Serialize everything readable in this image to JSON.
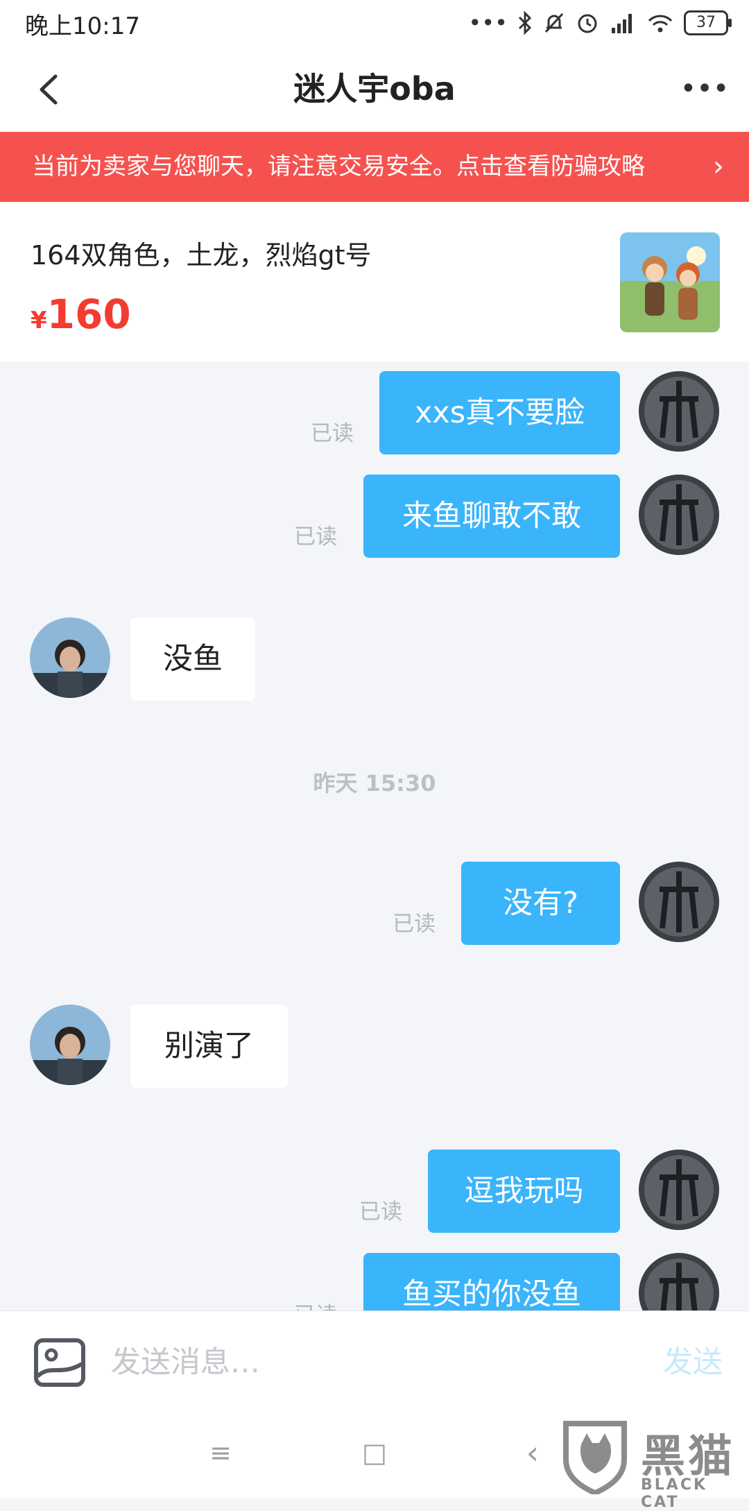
{
  "status_bar": {
    "time": "晚上10:17",
    "battery": "37",
    "icons": [
      "dots-icon",
      "bluetooth-icon",
      "mute-icon",
      "alarm-icon",
      "signal-icon",
      "wifi-icon",
      "battery-icon"
    ]
  },
  "header": {
    "title": "迷人宇oba",
    "more": "•••"
  },
  "banner": {
    "text": "当前为卖家与您聊天，请注意交易安全。点击查看防骗攻略",
    "arrow": "›"
  },
  "product": {
    "title": "164双角色，土龙，烈焰gt号",
    "currency": "¥",
    "price": "160"
  },
  "messages": [
    {
      "side": "me",
      "text": "xxs真不要脸",
      "status": "已读"
    },
    {
      "side": "me",
      "text": "来鱼聊敢不敢",
      "status": "已读"
    },
    {
      "side": "other",
      "text": "没鱼"
    },
    {
      "type": "time",
      "text": "昨天 15:30"
    },
    {
      "side": "me",
      "text": "没有?",
      "status": "已读"
    },
    {
      "side": "other",
      "text": "别演了"
    },
    {
      "side": "me",
      "text": "逗我玩吗",
      "status": "已读"
    },
    {
      "side": "me",
      "text": "鱼买的你没鱼",
      "status": "已读"
    }
  ],
  "input": {
    "placeholder": "发送消息…",
    "send_label": "发送"
  },
  "nav": {
    "menu": "≡",
    "home": "□",
    "back": "‹"
  },
  "watermark": {
    "text": "黑猫",
    "sub": "BLACK CAT"
  },
  "colors": {
    "accent": "#3ab4fb",
    "banner": "#f5524f",
    "price": "#f33b30",
    "background": "#f3f5f9"
  }
}
